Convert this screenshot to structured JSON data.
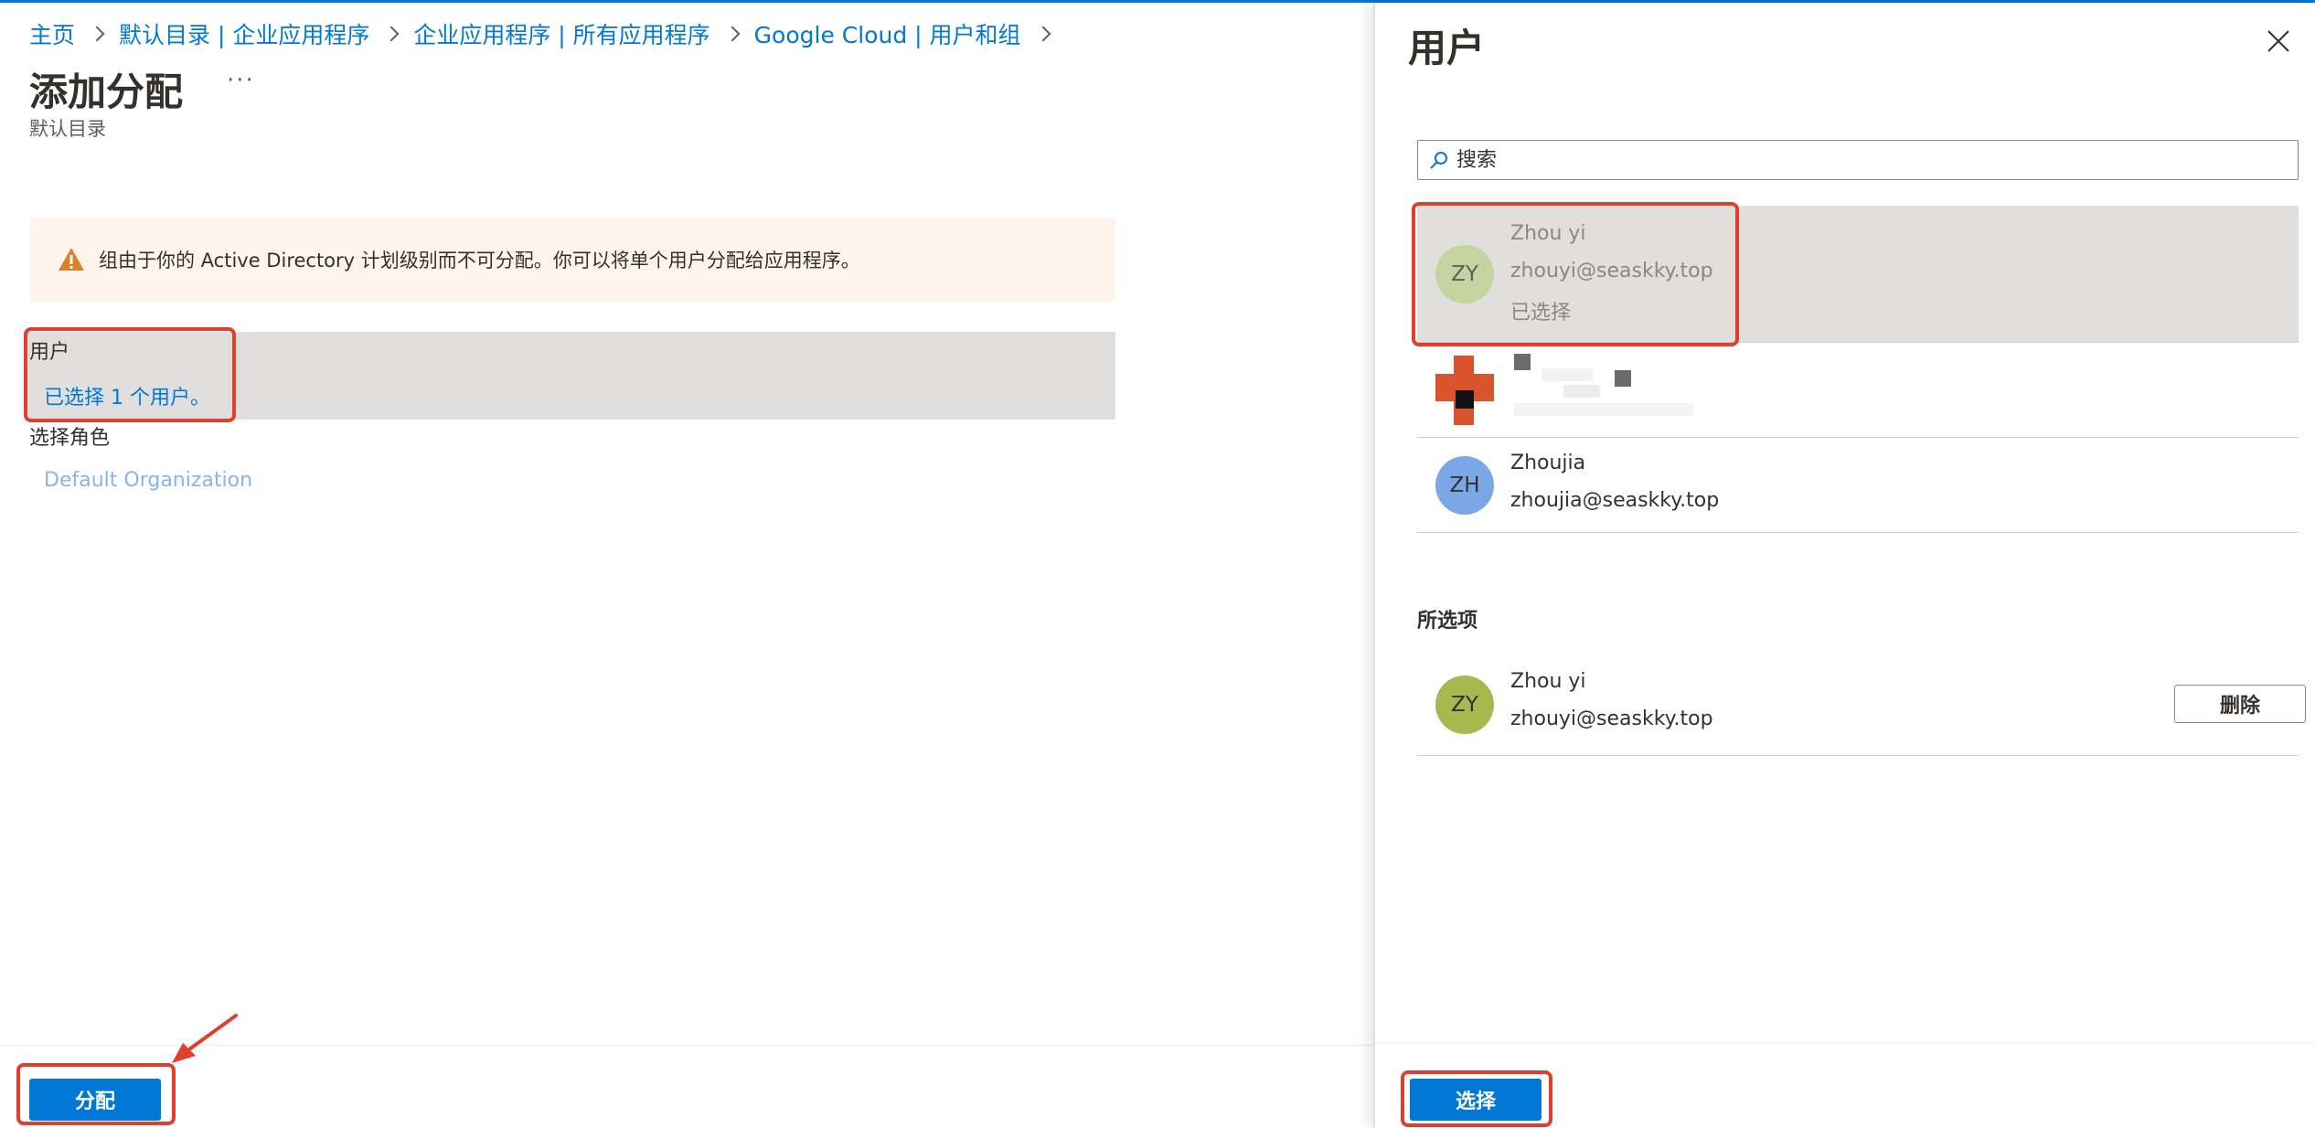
{
  "breadcrumb": [
    "主页",
    "默认目录 | 企业应用程序",
    "企业应用程序 | 所有应用程序",
    "Google Cloud | 用户和组"
  ],
  "page": {
    "title": "添加分配",
    "more": "···",
    "subtitle": "默认目录"
  },
  "warning": {
    "icon": "warning-icon",
    "text": "组由于你的 Active Directory 计划级别而不可分配。你可以将单个用户分配给应用程序。"
  },
  "assignment": {
    "users_label": "用户",
    "users_value": "已选择 1 个用户。",
    "role_label": "选择角色",
    "role_value": "Default Organization"
  },
  "footer": {
    "assign_label": "分配"
  },
  "blade": {
    "title": "用户",
    "close_icon": "close-icon",
    "search_placeholder": "搜索",
    "results": [
      {
        "initials": "ZY",
        "name": "Zhou yi",
        "email": "zhouyi@seaskky.top",
        "status": "已选择",
        "avatar_color": "#c5d49f"
      },
      {
        "initials": "",
        "name": "",
        "email": "",
        "status": "",
        "avatar_color": "#d9532c"
      },
      {
        "initials": "ZH",
        "name": "Zhoujia",
        "email": "zhoujia@seaskky.top",
        "status": "",
        "avatar_color": "#7ba7e6"
      }
    ],
    "selected_header": "所选项",
    "selected": [
      {
        "initials": "ZY",
        "name": "Zhou yi",
        "email": "zhouyi@seaskky.top",
        "avatar_color": "#a6b84e",
        "remove_label": "删除"
      }
    ],
    "select_label": "选择"
  },
  "colors": {
    "accent": "#0078d4",
    "annotation": "#e03f2e",
    "warning_bg": "#fff4ec",
    "warning_icon": "#d9822b"
  }
}
